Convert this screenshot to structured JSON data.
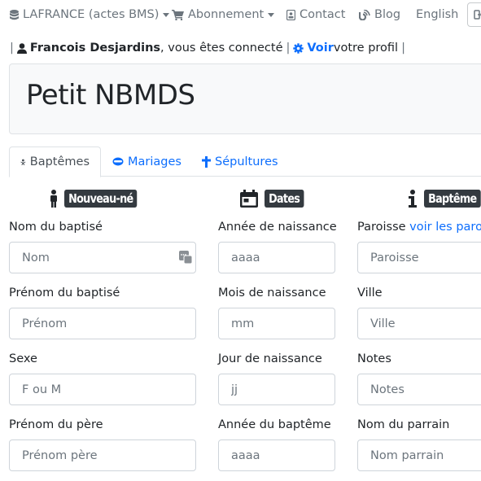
{
  "navbar": {
    "items": [
      {
        "label": "LAFRANCE (actes BMS)",
        "icon": "database-icon",
        "dropdown": true
      },
      {
        "label": "Abonnement",
        "icon": "cart-icon",
        "dropdown": true
      },
      {
        "label": "Contact",
        "icon": "address-card-icon",
        "dropdown": false
      },
      {
        "label": "Blog",
        "icon": "blog-icon",
        "dropdown": false
      },
      {
        "label": "English",
        "icon": null,
        "dropdown": false
      }
    ]
  },
  "user": {
    "name": "Francois Desjardins",
    "connected_text": ", vous êtes connecté",
    "profile_link": "Voir",
    "profile_text": " votre profil",
    "separator": "|"
  },
  "page": {
    "title": "Petit NBMDS"
  },
  "tabs": [
    {
      "label": "Baptêmes",
      "icon": "baby-icon",
      "active": true
    },
    {
      "label": "Mariages",
      "icon": "ring-icon",
      "active": false
    },
    {
      "label": "Sépultures",
      "icon": "cross-icon",
      "active": false
    }
  ],
  "sections": {
    "newborn": {
      "title": "Nouveau-né",
      "icon": "person-icon"
    },
    "dates": {
      "title": "Dates",
      "icon": "calendar-icon"
    },
    "baptism": {
      "title": "Baptême",
      "icon": "info-icon"
    }
  },
  "form": {
    "col1": [
      {
        "label": "Nom du baptisé",
        "placeholder": "Nom"
      },
      {
        "label": "Prénom du baptisé",
        "placeholder": "Prénom"
      },
      {
        "label": "Sexe",
        "placeholder": "F ou M"
      },
      {
        "label": "Prénom du père",
        "placeholder": "Prénom père"
      }
    ],
    "col2": [
      {
        "label": "Année de naissance",
        "placeholder": "aaaa"
      },
      {
        "label": "Mois de naissance",
        "placeholder": "mm"
      },
      {
        "label": "Jour de naissance",
        "placeholder": "jj"
      },
      {
        "label": "Année du baptême",
        "placeholder": "aaaa"
      }
    ],
    "col3": [
      {
        "label": "Paroisse",
        "link": "voir les paroisses",
        "placeholder": "Paroisse"
      },
      {
        "label": "Ville",
        "placeholder": "Ville"
      },
      {
        "label": "Notes",
        "placeholder": "Notes"
      },
      {
        "label": "Nom du parrain",
        "placeholder": "Nom parrain"
      }
    ]
  },
  "colors": {
    "link": "#0d6efd",
    "muted": "#6c757d",
    "badge_bg": "#343a40",
    "jumbotron_bg": "#f8f9fa"
  }
}
